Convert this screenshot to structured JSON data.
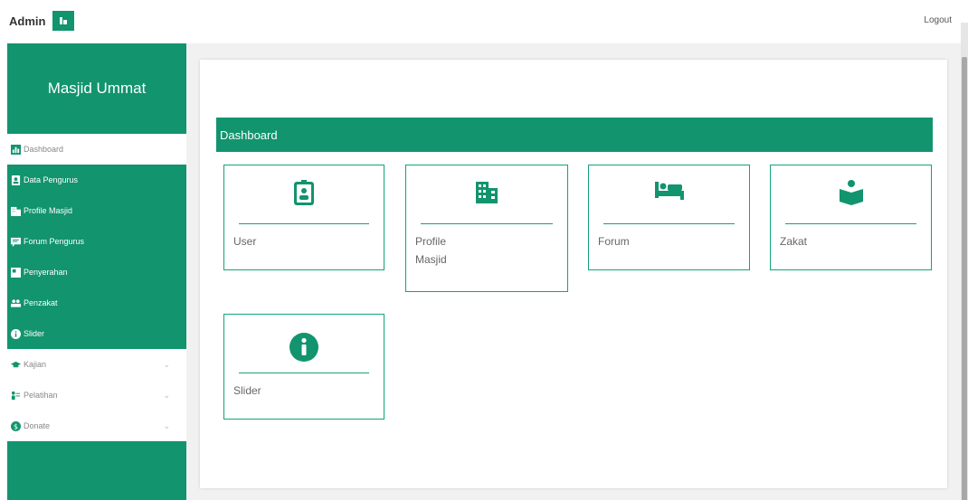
{
  "topbar": {
    "brand": "Admin",
    "logout": "Logout"
  },
  "sidebar": {
    "title": "Masjid Ummat",
    "items": [
      {
        "label": "Dashboard",
        "icon": "dashboard-icon"
      },
      {
        "label": "Data Pengurus",
        "icon": "user-icon"
      },
      {
        "label": "Profile Masjid",
        "icon": "building-icon"
      },
      {
        "label": "Forum Pengurus",
        "icon": "chat-icon"
      },
      {
        "label": "Penyerahan",
        "icon": "handover-icon"
      },
      {
        "label": "Penzakat",
        "icon": "users-icon"
      },
      {
        "label": "Slider",
        "icon": "info-icon"
      },
      {
        "label": "Kajian",
        "icon": "graduation-cap-icon"
      },
      {
        "label": "Pelatihan",
        "icon": "training-icon"
      },
      {
        "label": "Donate",
        "icon": "dollar-icon"
      }
    ]
  },
  "main": {
    "heading": "Dashboard",
    "cards": [
      {
        "label": "User",
        "icon": "id-badge-icon"
      },
      {
        "label": "Profile Masjid",
        "icon": "building-icon"
      },
      {
        "label": "Forum",
        "icon": "bed-icon"
      },
      {
        "label": "Zakat",
        "icon": "reader-icon"
      },
      {
        "label": "Slider",
        "icon": "info-circle-icon"
      }
    ]
  },
  "colors": {
    "accent": "#12946e",
    "border": "#13a37a"
  }
}
